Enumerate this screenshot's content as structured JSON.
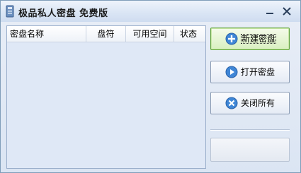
{
  "window": {
    "title": "极品私人密盘 免费版"
  },
  "titlebar": {
    "minimize_icon": "minimize-icon",
    "close_icon": "close-icon"
  },
  "list": {
    "columns": [
      "密盘名称",
      "盘符",
      "可用空间",
      "状态"
    ],
    "rows": []
  },
  "buttons": {
    "new_disk": "新建密盘",
    "open_disk": "打开密盘",
    "close_all": "关闭所有",
    "blank": ""
  },
  "icons": {
    "new": "plus-circle-icon",
    "open": "play-circle-icon",
    "close": "x-circle-icon"
  },
  "colors": {
    "accent_green": "#5fa23a",
    "icon_blue": "#3f86d6",
    "list_bg": "#dfe8f6"
  }
}
